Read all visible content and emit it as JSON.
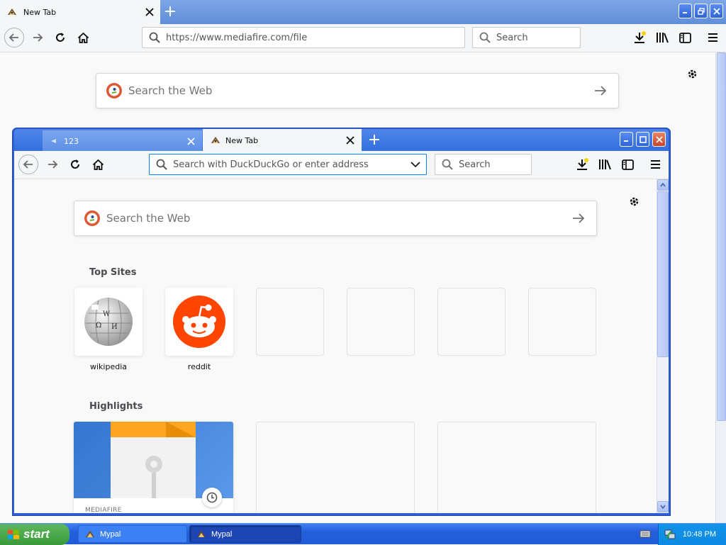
{
  "outer": {
    "tab_title": "New Tab",
    "url": "https://www.mediafire.com/file",
    "search_placeholder": "Search",
    "web_search_placeholder": "Search the Web"
  },
  "inner": {
    "tabs": [
      {
        "label": "123"
      },
      {
        "label": "New Tab"
      }
    ],
    "address_placeholder": "Search with DuckDuckGo or enter address",
    "search_placeholder": "Search",
    "web_search_placeholder": "Search the Web",
    "top_sites_title": "Top Sites",
    "top_sites": [
      {
        "label": "wikipedia",
        "icon": "wikipedia-globe-icon"
      },
      {
        "label": "reddit",
        "icon": "reddit-alien-icon"
      }
    ],
    "highlights_title": "Highlights",
    "highlights": [
      {
        "source": "MEDIAFIRE",
        "icon": "clock-icon"
      }
    ]
  },
  "taskbar": {
    "start_label": "start",
    "tasks": [
      {
        "label": "Mypal"
      },
      {
        "label": "Mypal"
      }
    ],
    "clock": "10:48 PM"
  },
  "colors": {
    "xp_blue": "#245edb",
    "start_green": "#3a9a3a",
    "reddit_orange": "#ff4500",
    "download_arrow_accent": "#ffd200"
  }
}
